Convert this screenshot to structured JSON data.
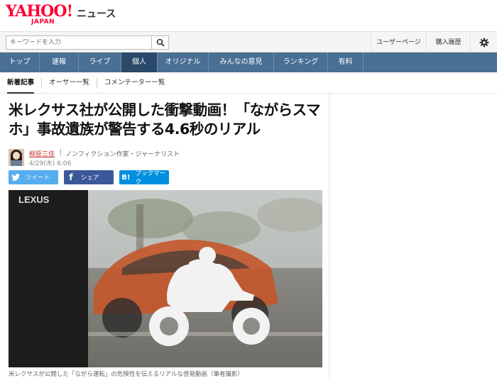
{
  "header": {
    "logo_main": "YAHOO!",
    "logo_sub": "JAPAN",
    "site_name": "ニュース"
  },
  "search": {
    "placeholder": "キーワードを入力"
  },
  "user_links": {
    "user_page": "ユーザーページ",
    "history": "購入履歴"
  },
  "nav": {
    "items": [
      {
        "label": "トップ"
      },
      {
        "label": "速報"
      },
      {
        "label": "ライブ"
      },
      {
        "label": "個人"
      },
      {
        "label": "オリジナル"
      },
      {
        "label": "みんなの意見"
      },
      {
        "label": "ランキング"
      },
      {
        "label": "有料"
      }
    ],
    "active": "個人"
  },
  "subnav": {
    "items": [
      {
        "label": "新着記事"
      },
      {
        "label": "オーサー一覧"
      },
      {
        "label": "コメンテーター一覧"
      }
    ]
  },
  "article": {
    "title": "米レクサス社が公開した衝撃動画！「ながらスマホ」事故遺族が警告する4.6秒のリアル",
    "author_name": "柳原三佳",
    "author_separator": "|",
    "author_title": "ノンフィクション作家・ジャーナリスト",
    "date": "4/29(木) 6:06",
    "image_brand": "LEXUS",
    "caption": "米レクサスが公開した「ながら運転」の危険性を伝えるリアルな啓発動画（筆者撮影）"
  },
  "share": {
    "twitter": "ツイート",
    "facebook": "シェア",
    "hatena": "ブックマーク",
    "hatena_mark": "B!",
    "facebook_mark": "f"
  },
  "colors": {
    "brand_red": "#ff0033",
    "nav_bg": "#4a6f94",
    "nav_active": "#2b4a6a",
    "twitter": "#55acee",
    "facebook": "#3b5998",
    "hatena": "#008fde"
  }
}
